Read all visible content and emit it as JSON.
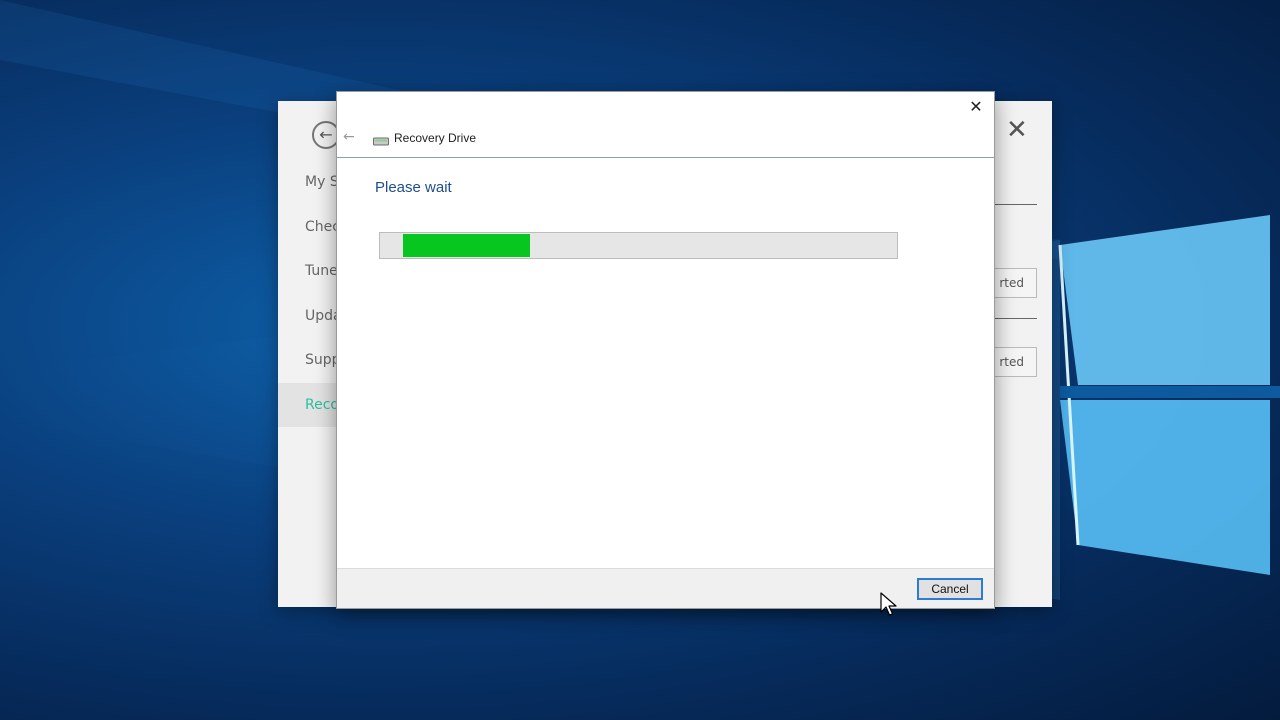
{
  "background_window": {
    "nav_items": [
      "My S",
      "Chec",
      "Tune",
      "Upda",
      "Supp",
      "Reco"
    ],
    "active_index": 5,
    "active_color": "#2cbfa4",
    "right_buttons": [
      "rted",
      "rted"
    ]
  },
  "dialog": {
    "title": "Recovery Drive",
    "heading": "Please wait",
    "progress": {
      "start": 0.045,
      "value": 0.29,
      "color": "#06c61f"
    },
    "cancel_label": "Cancel",
    "close_symbol": "✕",
    "back_symbol": "←"
  }
}
